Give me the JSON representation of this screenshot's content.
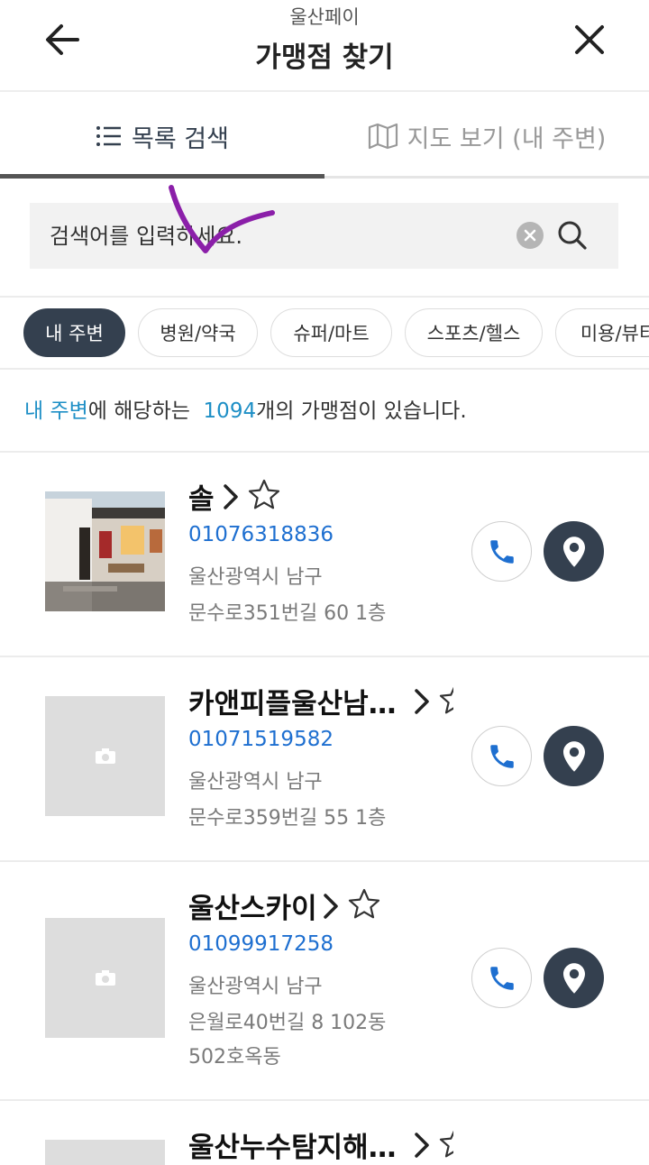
{
  "header": {
    "app_name": "울산페이",
    "title": "가맹점 찾기"
  },
  "tabs": {
    "list_label": "목록 검색",
    "map_label": "지도 보기 (내 주변)"
  },
  "search": {
    "placeholder": "검색어를 입력하세요."
  },
  "chips": [
    "내 주변",
    "병원/약국",
    "슈퍼/마트",
    "스포츠/헬스",
    "미용/뷰티"
  ],
  "summary": {
    "scope": "내 주변",
    "text_a": "에 해당하는",
    "count": "1094",
    "text_b": "개의 가맹점이 있습니다."
  },
  "stores": [
    {
      "name": "솔",
      "phone": "01076318836",
      "addr1": "울산광역시 남구",
      "addr2": "문수로351번길 60 1층",
      "addr3": "",
      "photo": true
    },
    {
      "name": "카앤피플울산남…",
      "phone": "01071519582",
      "addr1": "울산광역시 남구",
      "addr2": "문수로359번길 55 1층",
      "addr3": "",
      "photo": false
    },
    {
      "name": "울산스카이",
      "phone": "01099917258",
      "addr1": "울산광역시 남구",
      "addr2": "은월로40번길 8 102동",
      "addr3": "502호옥동",
      "photo": false
    },
    {
      "name": "울산누수탐지해…",
      "phone": "",
      "addr1": "",
      "addr2": "",
      "addr3": "",
      "photo": false
    }
  ],
  "colors": {
    "accent": "#1e8fc6",
    "phone": "#1e6fd0",
    "navy": "#34404f",
    "annotation": "#8b1fa9"
  }
}
